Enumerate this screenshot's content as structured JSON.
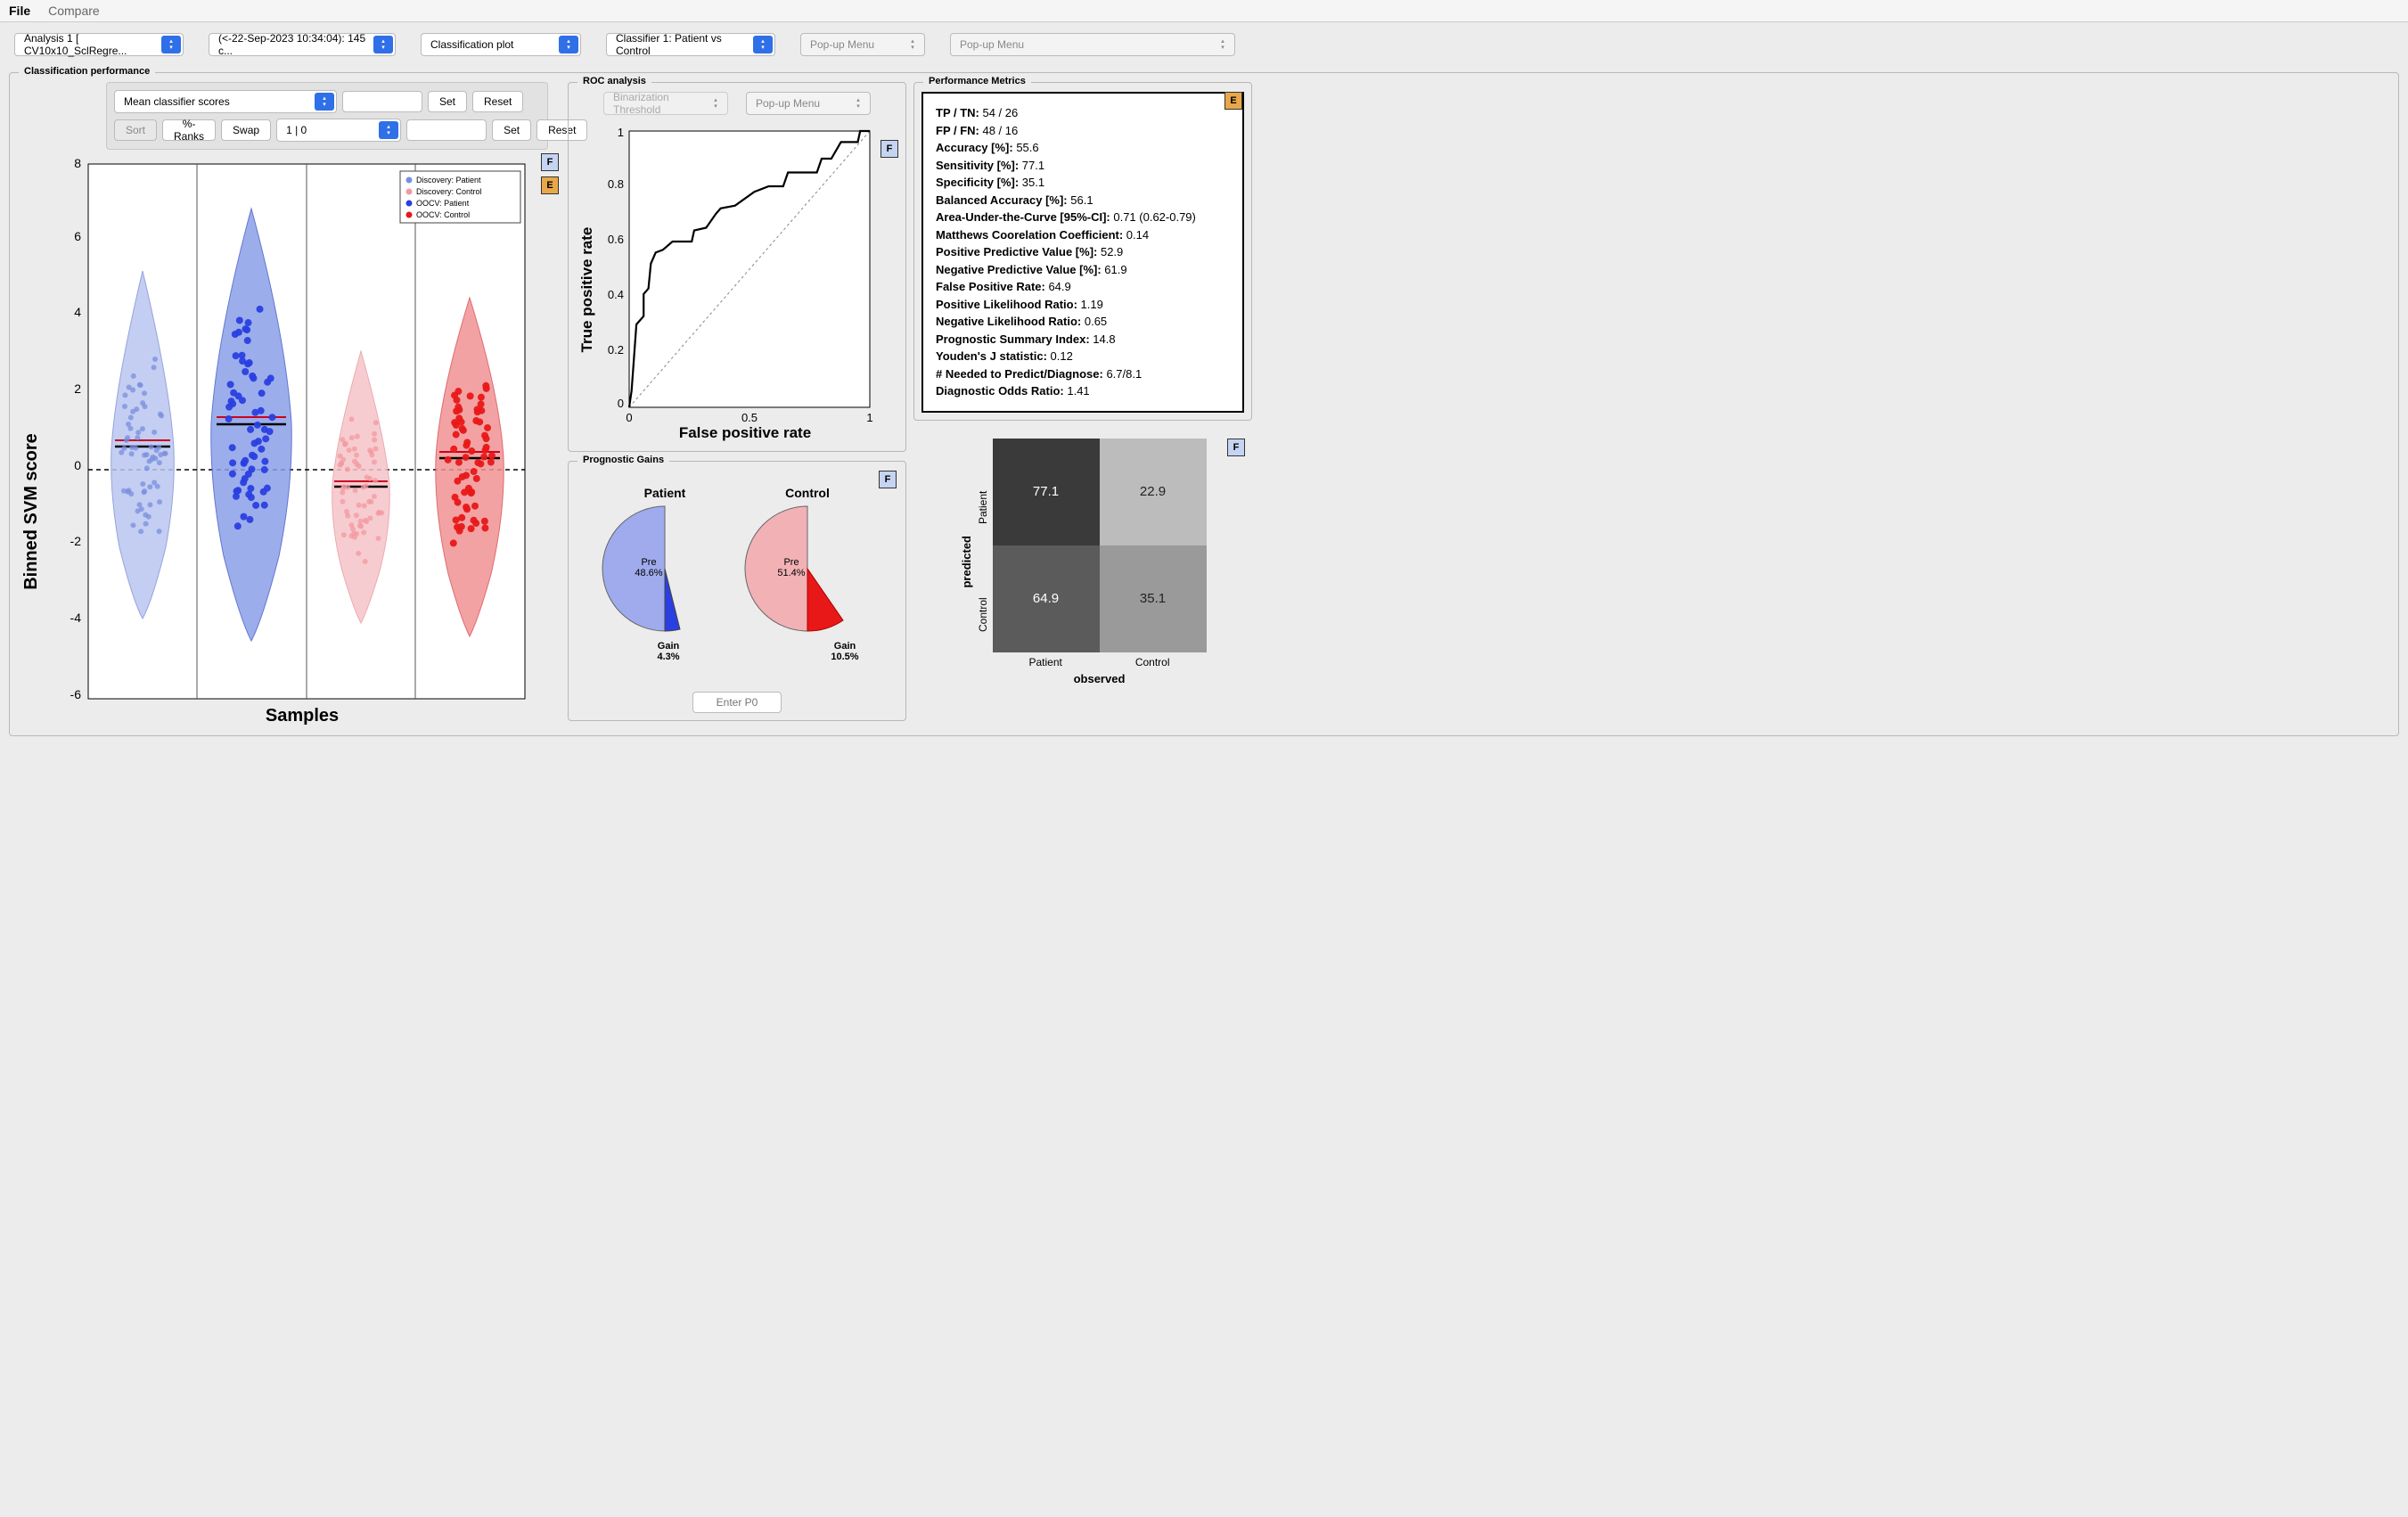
{
  "menubar": {
    "file": "File",
    "compare": "Compare"
  },
  "toolbar": {
    "analysis": "Analysis 1 [ CV10x10_SclRegre...",
    "timestamp": "(<-22-Sep-2023 10:34:04): 145 c...",
    "plot_type": "Classification plot",
    "classifier": "Classifier 1: Patient vs Control",
    "popup1": "Pop-up Menu",
    "popup2": "Pop-up Menu"
  },
  "panel_title": "Classification performance",
  "controls": {
    "score_select": "Mean classifier scores",
    "set": "Set",
    "reset": "Reset",
    "sort": "Sort",
    "ranks": "%-Ranks",
    "swap": "Swap",
    "order": "1 |  0"
  },
  "violin": {
    "ylabel": "Binned SVM score",
    "xlabel": "Samples",
    "yticks": [
      -6,
      -4,
      -2,
      0,
      2,
      4,
      6,
      8
    ],
    "legend": [
      "Discovery: Patient",
      "Discovery: Control",
      "OOCV: Patient",
      "OOCV: Control"
    ]
  },
  "roc": {
    "title": "ROC analysis",
    "bin_thresh": "Binarization Threshold",
    "popup": "Pop-up Menu",
    "ylabel": "True positive rate",
    "xlabel": "False positive rate",
    "yticks": [
      "0",
      "0.2",
      "0.4",
      "0.6",
      "0.8",
      "1"
    ],
    "xticks": [
      "0",
      "0.5",
      "1"
    ]
  },
  "metrics": {
    "title": "Performance Metrics",
    "rows": [
      {
        "label": "TP / TN:",
        "val": "54 / 26"
      },
      {
        "label": "FP / FN:",
        "val": "48 / 16"
      },
      {
        "label": "Accuracy [%]:",
        "val": "55.6"
      },
      {
        "label": "Sensitivity [%]:",
        "val": "77.1"
      },
      {
        "label": "Specificity [%]:",
        "val": "35.1"
      },
      {
        "label": "Balanced Accuracy [%]:",
        "val": "56.1"
      },
      {
        "label": "Area-Under-the-Curve [95%-CI]:",
        "val": "0.71 (0.62-0.79)"
      },
      {
        "label": "Matthews Coorelation Coefficient:",
        "val": "0.14"
      },
      {
        "label": "Positive Predictive Value [%]:",
        "val": "52.9"
      },
      {
        "label": "Negative Predictive Value [%]:",
        "val": "61.9"
      },
      {
        "label": "False Positive Rate:",
        "val": "64.9"
      },
      {
        "label": "Positive Likelihood Ratio:",
        "val": "1.19"
      },
      {
        "label": "Negative Likelihood Ratio:",
        "val": "0.65"
      },
      {
        "label": "Prognostic Summary Index:",
        "val": "14.8"
      },
      {
        "label": "Youden's J statistic:",
        "val": "0.12"
      },
      {
        "label": "# Needed to Predict/Diagnose:",
        "val": "6.7/8.1"
      },
      {
        "label": "Diagnostic Odds Ratio:",
        "val": "1.41"
      }
    ]
  },
  "gains": {
    "title": "Prognostic Gains",
    "patient": "Patient",
    "control": "Control",
    "pre_p": "Pre\n48.6%",
    "gain_p": "Gain\n4.3%",
    "pre_c": "Pre\n51.4%",
    "gain_c": "Gain\n10.5%",
    "enter_p0": "Enter P0"
  },
  "conf": {
    "ylabel": "predicted",
    "xlabel": "observed",
    "rows": [
      "Patient",
      "Control"
    ],
    "cols": [
      "Patient",
      "Control"
    ],
    "cells": [
      [
        "77.1",
        "22.9"
      ],
      [
        "64.9",
        "35.1"
      ]
    ]
  },
  "badges": {
    "F": "F",
    "E": "E"
  },
  "chart_data": {
    "violin": {
      "type": "strip-violin",
      "groups": [
        "Discovery: Patient",
        "OOCV: Patient",
        "Discovery: Control",
        "OOCV: Control"
      ],
      "colors": [
        "#7a8edd",
        "#2a3fe0",
        "#f19aa0",
        "#e81818"
      ],
      "means": [
        0.6,
        1.2,
        -0.45,
        0.3
      ],
      "yrange": [
        -6,
        8
      ],
      "ylabel": "Binned SVM score",
      "xlabel": "Samples"
    },
    "roc": {
      "type": "line",
      "xlabel": "False positive rate",
      "ylabel": "True positive rate",
      "xlim": [
        0,
        1
      ],
      "ylim": [
        0,
        1
      ],
      "curve": [
        [
          0,
          0
        ],
        [
          0.01,
          0.06
        ],
        [
          0.02,
          0.18
        ],
        [
          0.03,
          0.3
        ],
        [
          0.06,
          0.33
        ],
        [
          0.06,
          0.41
        ],
        [
          0.08,
          0.43
        ],
        [
          0.09,
          0.52
        ],
        [
          0.11,
          0.56
        ],
        [
          0.14,
          0.57
        ],
        [
          0.18,
          0.6
        ],
        [
          0.26,
          0.6
        ],
        [
          0.27,
          0.64
        ],
        [
          0.32,
          0.65
        ],
        [
          0.36,
          0.7
        ],
        [
          0.38,
          0.72
        ],
        [
          0.44,
          0.73
        ],
        [
          0.52,
          0.78
        ],
        [
          0.58,
          0.8
        ],
        [
          0.64,
          0.8
        ],
        [
          0.66,
          0.85
        ],
        [
          0.78,
          0.85
        ],
        [
          0.8,
          0.9
        ],
        [
          0.84,
          0.9
        ],
        [
          0.88,
          0.96
        ],
        [
          0.95,
          0.96
        ],
        [
          0.96,
          1.0
        ],
        [
          1.0,
          1.0
        ]
      ],
      "auc": 0.71
    },
    "gains": {
      "type": "pie-pair",
      "patient": {
        "pre": 48.6,
        "gain": 4.3
      },
      "control": {
        "pre": 51.4,
        "gain": 10.5
      }
    },
    "confusion": {
      "type": "heatmap",
      "rows": [
        "Patient",
        "Control"
      ],
      "cols": [
        "Patient",
        "Control"
      ],
      "values": [
        [
          77.1,
          22.9
        ],
        [
          64.9,
          35.1
        ]
      ],
      "row_axis": "predicted",
      "col_axis": "observed"
    }
  }
}
